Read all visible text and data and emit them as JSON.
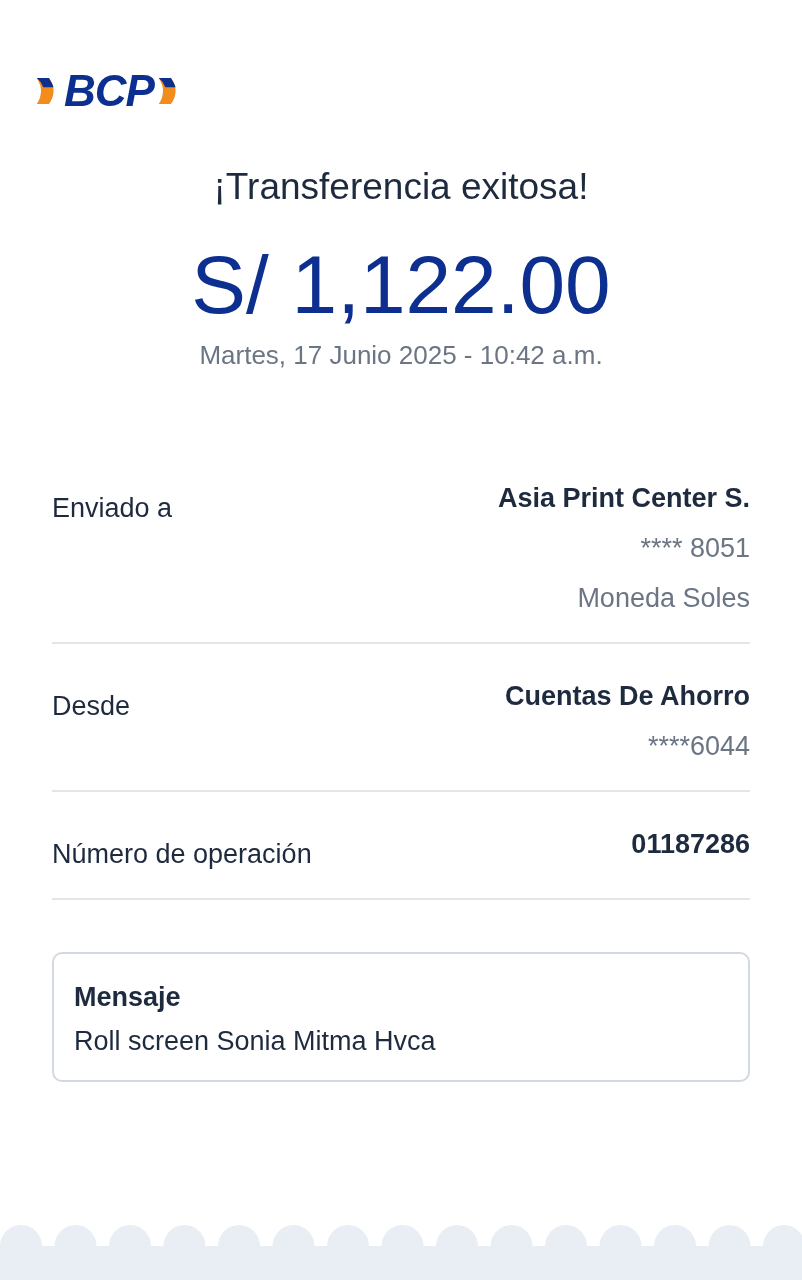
{
  "logo": {
    "text": "BCP"
  },
  "title": "¡Transferencia exitosa!",
  "amount": "S/ 1,122.00",
  "datetime": "Martes, 17 Junio 2025 - 10:42 a.m.",
  "details": [
    {
      "label": "Enviado a",
      "values": [
        {
          "text": "Asia Print Center S.",
          "kind": "main"
        },
        {
          "text": "**** 8051",
          "kind": "sub"
        },
        {
          "text": "Moneda Soles",
          "kind": "sub"
        }
      ]
    },
    {
      "label": "Desde",
      "values": [
        {
          "text": "Cuentas De Ahorro",
          "kind": "main"
        },
        {
          "text": "****6044",
          "kind": "sub"
        }
      ]
    },
    {
      "label": "Número de operación",
      "values": [
        {
          "text": "01187286",
          "kind": "main"
        }
      ]
    }
  ],
  "message": {
    "title": "Mensaje",
    "text": "Roll screen Sonia Mitma Hvca"
  }
}
